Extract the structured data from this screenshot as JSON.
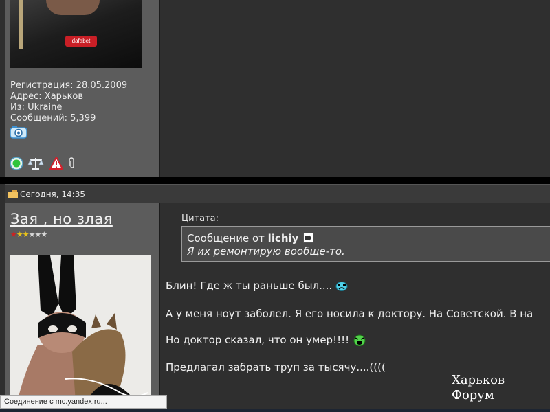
{
  "top_post": {
    "avatar_logo": "dafabet",
    "registration": "Регистрация: 28.05.2009",
    "address": "Адрес: Харьков",
    "from": "Из: Ukraine",
    "messages": "Сообщений: 5,399",
    "status_icons": [
      "camera-icon",
      "online-icon",
      "scales-icon",
      "warning-icon",
      "paperclip-icon"
    ]
  },
  "post": {
    "date": "Сегодня, 14:35",
    "username": "Зая , но злая",
    "rating": {
      "filled": 3,
      "total": 6
    },
    "quote": {
      "label": "Цитата:",
      "prefix": "Сообщение от ",
      "author": "lichiy",
      "text": "Я их ремонтирую вообще-то."
    },
    "lines": [
      "Блин! Где ж ты раньше был....",
      "А у меня ноут заболел. Я его носила к доктору. На Советской. В на",
      "Но доктор сказал, что он умер!!!!",
      "Предлагал забрать труп за тысячу....(((("
    ],
    "watermark": "Харьков Форум"
  },
  "status_bar": {
    "text": "Соединение с mc.yandex.ru..."
  },
  "colors": {
    "panel": "#5c5c5c",
    "background": "#2f2f2f",
    "text": "#f0f0f0",
    "star": "#e8c21a",
    "star_first": "#cc2222"
  }
}
